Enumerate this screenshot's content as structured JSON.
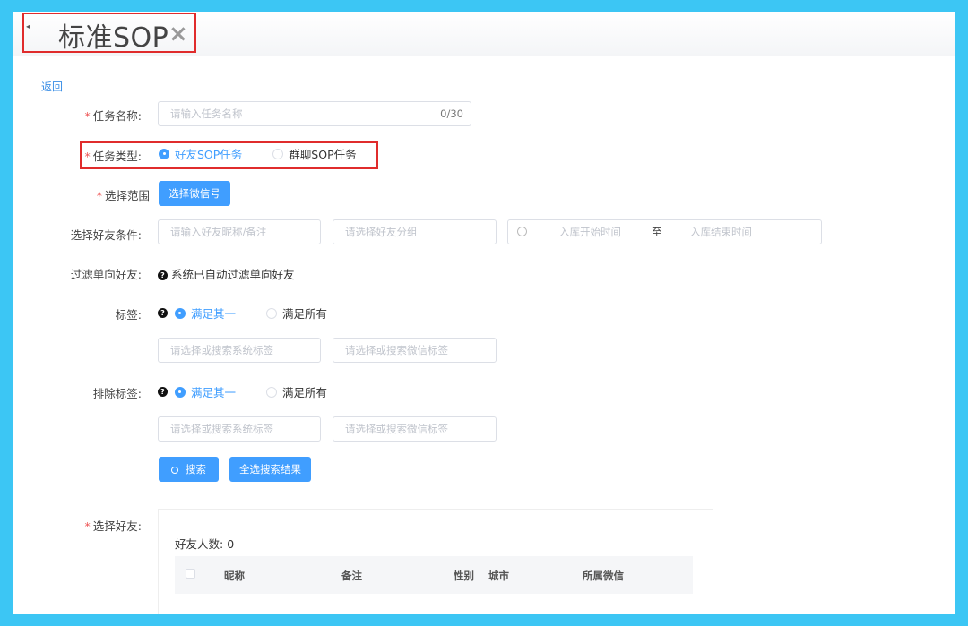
{
  "tab": {
    "title": "标准SOP",
    "close": "×",
    "collapse": "◂"
  },
  "back": "返回",
  "task_name": {
    "label": "任务名称:",
    "required": "*",
    "placeholder": "请输入任务名称",
    "counter": "0/30"
  },
  "task_type": {
    "label": "任务类型:",
    "required": "*",
    "options": [
      "好友SOP任务",
      "群聊SOP任务"
    ],
    "selected": 0
  },
  "scope": {
    "label": "选择范围",
    "required": "*",
    "button": "选择微信号"
  },
  "friend_condition": {
    "label": "选择好友条件:",
    "nickname_placeholder": "请输入好友昵称/备注",
    "group_placeholder": "请选择好友分组",
    "date_start": "入库开始时间",
    "date_sep": "至",
    "date_end": "入库结束时间"
  },
  "filter_single": {
    "label": "过滤单向好友:",
    "text": "系统已自动过滤单向好友"
  },
  "tags": {
    "label": "标签:",
    "options": [
      "满足其一",
      "满足所有"
    ],
    "system_placeholder": "请选择或搜索系统标签",
    "wechat_placeholder": "请选择或搜索微信标签"
  },
  "exclude_tags": {
    "label": "排除标签:",
    "options": [
      "满足其一",
      "满足所有"
    ],
    "system_placeholder": "请选择或搜索系统标签",
    "wechat_placeholder": "请选择或搜索微信标签"
  },
  "actions": {
    "search": "搜索",
    "select_all": "全选搜索结果"
  },
  "select_friends": {
    "label": "选择好友:",
    "required": "*",
    "count_label": "好友人数:",
    "count": "0",
    "columns": [
      "昵称",
      "备注",
      "性别",
      "城市",
      "所属微信"
    ]
  },
  "colors": {
    "accent": "#409eff",
    "frame": "#3cc6f4",
    "highlight": "#e02c2c"
  }
}
